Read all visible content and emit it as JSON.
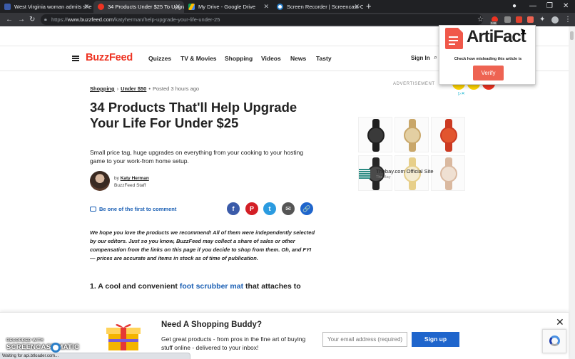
{
  "browser": {
    "tabs": [
      {
        "title": "West Virginia woman admits she",
        "favicon_color": "#3b5ba9",
        "active": false
      },
      {
        "title": "34 Products Under $25 To Upgra",
        "favicon_color": "#ee3322",
        "active": true
      },
      {
        "title": "My Drive - Google Drive",
        "favicon_color": "#fbbc04",
        "active": false
      },
      {
        "title": "Screen Recorder | Screencast-O-",
        "favicon_color": "#2a7fc9",
        "active": false
      }
    ],
    "new_tab": "+",
    "url_scheme": "https://",
    "url_host": "www.buzzfeed.com",
    "url_path": "/katyherman/help-upgrade-your-life-under-25",
    "extension_badge": "346"
  },
  "site": {
    "logo": "BuzzFeed",
    "nav": [
      "Quizzes",
      "TV & Movies",
      "Shopping",
      "Videos",
      "News",
      "Tasty"
    ],
    "sign_in": "Sign In"
  },
  "article": {
    "breadcrumb": [
      "Shopping",
      "Under $50"
    ],
    "posted": "Posted 3 hours ago",
    "title": "34 Products That'll Help Upgrade Your Life For Under $25",
    "dek": "Small price tag, huge upgrades on everything from your cooking to your hosting game to your work-from home setup.",
    "by_prefix": "by",
    "author": "Katy Herman",
    "author_role": "BuzzFeed Staff",
    "comment_cta": "Be one of the first to comment",
    "share_icons": [
      {
        "name": "facebook-share-icon",
        "glyph": "f",
        "color": "#3b5ba9"
      },
      {
        "name": "pinterest-share-icon",
        "glyph": "P",
        "color": "#d31f26"
      },
      {
        "name": "twitter-share-icon",
        "glyph": "t",
        "color": "#2b9be0"
      },
      {
        "name": "email-share-icon",
        "glyph": "✉",
        "color": "#555555"
      },
      {
        "name": "copy-link-icon",
        "glyph": "🔗",
        "color": "#1f65cc"
      }
    ],
    "disclaimer": "We hope you love the products we recommend! All of them were independently selected by our editors. Just so you know, BuzzFeed may collect a share of sales or other compensation from the links on this page if you decide to shop from them. Oh, and FYI — prices are accurate and items in stock as of time of publication.",
    "item1_prefix": "1. A cool and convenient",
    "item1_link": "foot scrubber mat",
    "item1_suffix": "that attaches to"
  },
  "ad": {
    "label": "ADVERTISEMENT",
    "advertiser": "Thebay.com Official Site",
    "advertiser_sub": "The Bay",
    "products": [
      {
        "band": "#1e1e1e",
        "face": "#3a3a3a"
      },
      {
        "band": "#c9a76a",
        "face": "#e3cfa2"
      },
      {
        "band": "#cc3a22",
        "face": "#e2552f"
      },
      {
        "band": "#262626",
        "face": "#4a4a4a"
      },
      {
        "band": "#e7cf8a",
        "face": "#f4ecd2"
      },
      {
        "band": "#dab9a0",
        "face": "#efe0d2"
      }
    ]
  },
  "extension_popup": {
    "brand": "ArtiFact",
    "tagline": "Check how misleading this article is",
    "button": "Verify"
  },
  "newsletter": {
    "heading": "Need A Shopping Buddy?",
    "text": "Get great products - from pros in the fine art of buying stuff online - delivered to your inbox!",
    "email_placeholder": "Your email address (required)",
    "signup": "Sign up",
    "close": "✕"
  },
  "watermark": {
    "line1": "RECORDED WITH",
    "line2": "SCREENCAST    MATIC"
  },
  "status": "Waiting for api.btloader.com..."
}
